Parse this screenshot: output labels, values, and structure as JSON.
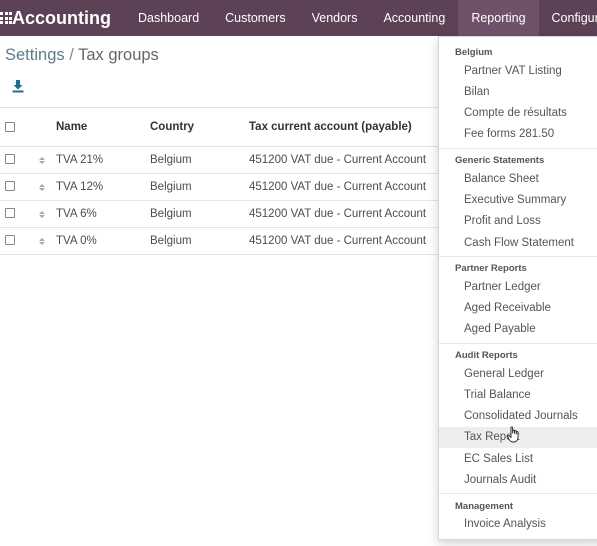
{
  "navbar": {
    "brand": "Accounting",
    "items": [
      "Dashboard",
      "Customers",
      "Vendors",
      "Accounting",
      "Reporting",
      "Configuration"
    ]
  },
  "breadcrumb": {
    "parent": "Settings",
    "separator": " / ",
    "current": "Tax groups"
  },
  "table": {
    "headers": {
      "name": "Name",
      "country": "Country",
      "account": "Tax current account (payable)"
    },
    "rows": [
      {
        "name": "TVA 21%",
        "country": "Belgium",
        "account": "451200 VAT due - Current Account"
      },
      {
        "name": "TVA 12%",
        "country": "Belgium",
        "account": "451200 VAT due - Current Account"
      },
      {
        "name": "TVA 6%",
        "country": "Belgium",
        "account": "451200 VAT due - Current Account"
      },
      {
        "name": "TVA 0%",
        "country": "Belgium",
        "account": "451200 VAT due - Current Account"
      }
    ]
  },
  "reporting_menu": {
    "sections": [
      {
        "header": "Belgium",
        "items": [
          "Partner VAT Listing",
          "Bilan",
          "Compte de résultats",
          "Fee forms 281.50"
        ]
      },
      {
        "header": "Generic Statements",
        "items": [
          "Balance Sheet",
          "Executive Summary",
          "Profit and Loss",
          "Cash Flow Statement"
        ]
      },
      {
        "header": "Partner Reports",
        "items": [
          "Partner Ledger",
          "Aged Receivable",
          "Aged Payable"
        ]
      },
      {
        "header": "Audit Reports",
        "items": [
          "General Ledger",
          "Trial Balance",
          "Consolidated Journals",
          "Tax Report",
          "EC Sales List",
          "Journals Audit"
        ]
      },
      {
        "header": "Management",
        "items": [
          "Invoice Analysis"
        ]
      }
    ]
  },
  "colors": {
    "navbar": "#5d4156",
    "navbar_active": "#6f5269",
    "link": "#5d7d8a",
    "download_icon": "#1f6f8b"
  }
}
